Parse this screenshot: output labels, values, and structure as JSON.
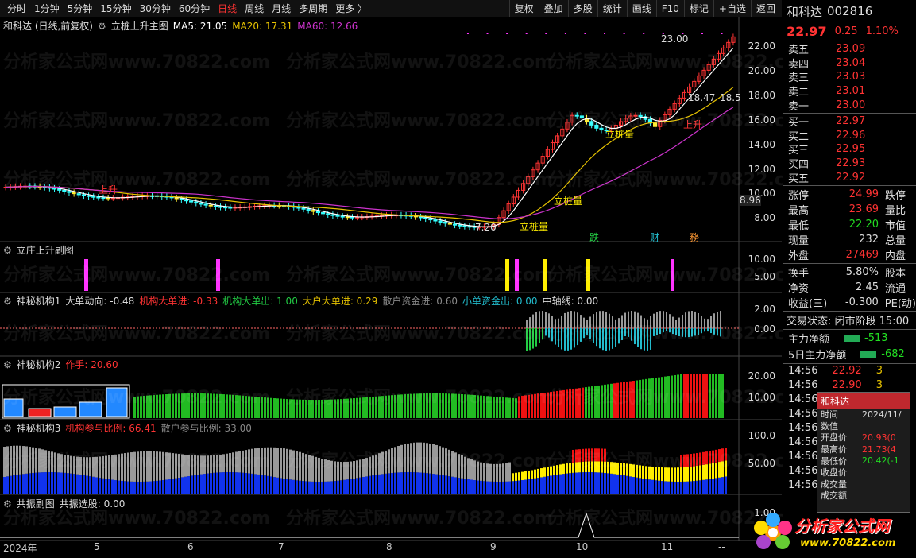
{
  "toolbar": {
    "periods": [
      "分时",
      "1分钟",
      "5分钟",
      "15分钟",
      "30分钟",
      "60分钟",
      "日线",
      "周线",
      "月线",
      "多周期",
      "更多 〉"
    ],
    "active_period": "日线",
    "tools": [
      "复权",
      "叠加",
      "多股",
      "统计",
      "画线",
      "F10",
      "标记",
      "+自选",
      "返回"
    ]
  },
  "main_pane": {
    "stock_label": "和科达 (日线,前复权)",
    "indicator_name": "立桩上升主图",
    "ma5": "MA5: 21.05",
    "ma20": "MA20: 17.31",
    "ma60": "MA60: 12.66",
    "axis": [
      "22.00",
      "20.00",
      "18.00",
      "16.00",
      "14.00",
      "12.00",
      "10.00",
      "8.00"
    ],
    "current_tag": "8.96",
    "annotations": {
      "high": "23.00",
      "mid": "18.47",
      "right": "18.5",
      "low": "7.20",
      "lizhuang1": "立桩量",
      "lizhuang2": "立桩量",
      "lizhuang3": "立桩量",
      "shangsheng1": "上升",
      "shangsheng2": "上升",
      "die": "跌",
      "cai": "财",
      "wu": "務"
    },
    "colors": {
      "ma5": "#ffffff",
      "ma20": "#e6c200",
      "ma60": "#cc33cc"
    }
  },
  "pane2": {
    "title": "立庄上升副图",
    "axis": [
      "10.00",
      "5.00"
    ]
  },
  "pane3": {
    "title": "神秘机构1",
    "fields": [
      {
        "text": "大单动向: -0.48",
        "color": "#dddddd"
      },
      {
        "text": "机构大单进: -0.33",
        "color": "#ff3333"
      },
      {
        "text": "机构大单出: 1.00",
        "color": "#22cc44"
      },
      {
        "text": "大户大单进: 0.29",
        "color": "#e6c200"
      },
      {
        "text": "散户资金进: 0.60",
        "color": "#888888"
      },
      {
        "text": "小单资金出: 0.00",
        "color": "#22bbcc"
      },
      {
        "text": "中轴线: 0.00",
        "color": "#dddddd"
      }
    ],
    "axis": [
      "2.00",
      "0.00"
    ]
  },
  "pane4": {
    "title": "神秘机构2",
    "fields": [
      {
        "text": "作手: 20.60",
        "color": "#ff3333"
      }
    ],
    "axis": [
      "20.00",
      "10.00"
    ]
  },
  "pane5": {
    "title": "神秘机构3",
    "fields": [
      {
        "text": "机构参与比例: 66.41",
        "color": "#ff3333"
      },
      {
        "text": "散户参与比例: 33.00",
        "color": "#888888"
      }
    ],
    "axis": [
      "100.0",
      "50.00"
    ]
  },
  "pane6": {
    "title": "共振副图",
    "field": "共振选股: 0.00",
    "axis": [
      "1.00"
    ]
  },
  "dates": [
    {
      "label": "2024年"
    },
    {
      "label": "5"
    },
    {
      "label": "6"
    },
    {
      "label": "7"
    },
    {
      "label": "8"
    },
    {
      "label": "9"
    },
    {
      "label": "10"
    },
    {
      "label": "11"
    },
    {
      "label": "--"
    }
  ],
  "watermark": "分析家公式网www.70822.com",
  "side": {
    "name": "和科达",
    "code": "002816",
    "price": "22.97",
    "change": "0.25",
    "pct": "1.10%",
    "asks": [
      {
        "label": "卖五",
        "price": "23.09"
      },
      {
        "label": "卖四",
        "price": "23.04"
      },
      {
        "label": "卖三",
        "price": "23.03"
      },
      {
        "label": "卖二",
        "price": "23.01"
      },
      {
        "label": "卖一",
        "price": "23.00"
      }
    ],
    "bids": [
      {
        "label": "买一",
        "price": "22.97"
      },
      {
        "label": "买二",
        "price": "22.96"
      },
      {
        "label": "买三",
        "price": "22.95"
      },
      {
        "label": "买四",
        "price": "22.93"
      },
      {
        "label": "买五",
        "price": "22.92"
      }
    ],
    "quotes1": [
      {
        "k1": "涨停",
        "v1": "24.99",
        "k2": "跌停",
        "c": "red"
      },
      {
        "k1": "最高",
        "v1": "23.69",
        "k2": "量比",
        "c": "red"
      },
      {
        "k1": "最低",
        "v1": "22.20",
        "k2": "市值",
        "c": "green"
      },
      {
        "k1": "现量",
        "v1": "232",
        "k2": "总量",
        "c": ""
      },
      {
        "k1": "外盘",
        "v1": "27469",
        "k2": "内盘",
        "c": "red"
      }
    ],
    "quotes2": [
      {
        "k1": "换手",
        "v1": "5.80%",
        "k2": "股本",
        "c": ""
      },
      {
        "k1": "净资",
        "v1": "2.45",
        "k2": "流通",
        "c": ""
      },
      {
        "k1": "收益(三)",
        "v1": "-0.300",
        "k2": "PE(动)",
        "c": ""
      }
    ],
    "status": "交易状态: 闭市阶段 15:00",
    "flows": [
      {
        "label": "主力净额",
        "value": "-513"
      },
      {
        "label": "5日主力净额",
        "value": "-682"
      }
    ],
    "ticks": [
      {
        "time": "14:56",
        "price": "22.92",
        "vol": "3"
      },
      {
        "time": "14:56",
        "price": "22.90",
        "vol": "3"
      },
      {
        "time": "14:56",
        "price": "",
        "vol": ""
      },
      {
        "time": "14:56",
        "price": "",
        "vol": ""
      },
      {
        "time": "14:56",
        "price": "",
        "vol": ""
      },
      {
        "time": "14:56",
        "price": "",
        "vol": ""
      },
      {
        "time": "14:56",
        "price": "",
        "vol": ""
      },
      {
        "time": "14:56",
        "price": "",
        "vol": ""
      },
      {
        "time": "14:56",
        "price": "",
        "vol": ""
      }
    ],
    "popup": {
      "title": "和科达",
      "rows": [
        {
          "k": "时间",
          "v": "2024/11/"
        },
        {
          "k": "数值",
          "v": ""
        },
        {
          "k": "开盘价",
          "v": "20.93(0"
        },
        {
          "k": "最高价",
          "v": "21.73(4"
        },
        {
          "k": "最低价",
          "v": "20.42(-1"
        },
        {
          "k": "收盘价",
          "v": ""
        },
        {
          "k": "成交量",
          "v": ""
        },
        {
          "k": "成交额",
          "v": ""
        }
      ]
    },
    "logo_text": "分析家公式网",
    "logo_url": "www.70822.com"
  }
}
